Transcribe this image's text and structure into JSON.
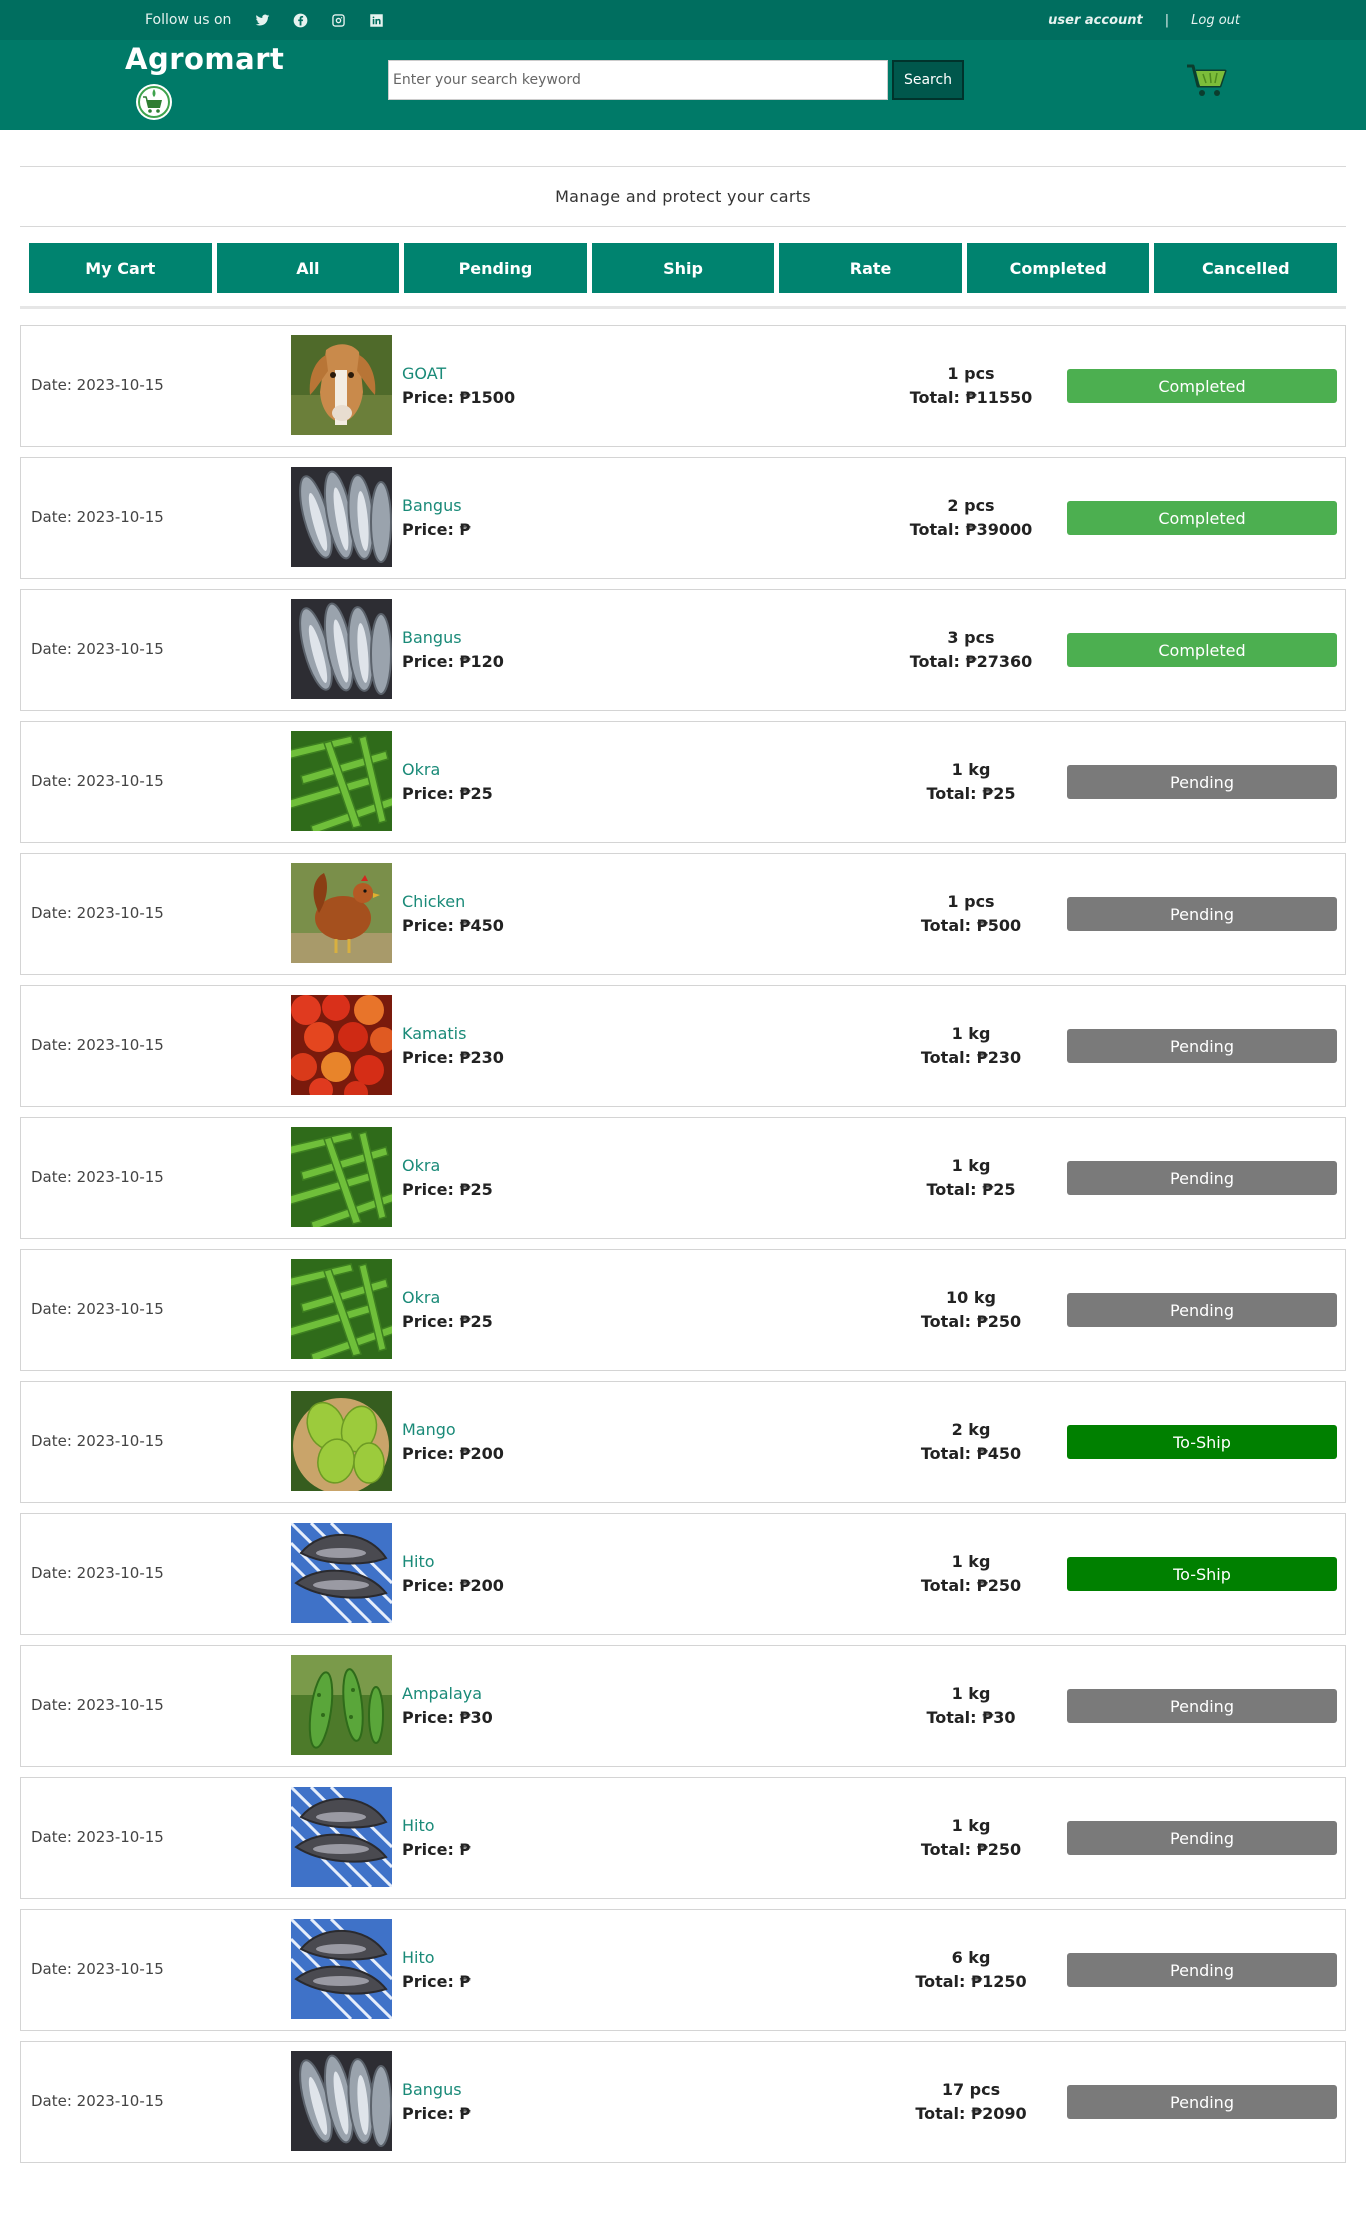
{
  "topbar": {
    "follow_label": "Follow us on",
    "social_icons": [
      "twitter-icon",
      "facebook-icon",
      "instagram-icon",
      "linkedin-icon"
    ],
    "user_account": "user account",
    "separator": "|",
    "logout": "Log out"
  },
  "header": {
    "brand": "Agromart",
    "search_placeholder": "Enter your search keyword",
    "search_button": "Search"
  },
  "banner": {
    "text": "Manage and protect your carts"
  },
  "tabs": [
    {
      "label": "My Cart"
    },
    {
      "label": "All"
    },
    {
      "label": "Pending"
    },
    {
      "label": "Ship"
    },
    {
      "label": "Rate"
    },
    {
      "label": "Completed"
    },
    {
      "label": "Cancelled"
    }
  ],
  "colors": {
    "topbar": "#006e5f",
    "header": "#007a68",
    "tab": "#00836f",
    "completed": "#4caf50",
    "pending": "#7a7a7a",
    "toship": "#008000"
  },
  "orders": [
    {
      "date": "Date: 2023-10-15",
      "name": "GOAT",
      "price": "Price: ₱1500",
      "qty": "1 pcs",
      "total": "Total: ₱11550",
      "status": "Completed",
      "status_kind": "completed",
      "image": "goat"
    },
    {
      "date": "Date: 2023-10-15",
      "name": "Bangus",
      "price": "Price: ₱",
      "qty": "2 pcs",
      "total": "Total: ₱39000",
      "status": "Completed",
      "status_kind": "completed",
      "image": "fish"
    },
    {
      "date": "Date: 2023-10-15",
      "name": "Bangus",
      "price": "Price: ₱120",
      "qty": "3 pcs",
      "total": "Total: ₱27360",
      "status": "Completed",
      "status_kind": "completed",
      "image": "fish"
    },
    {
      "date": "Date: 2023-10-15",
      "name": "Okra",
      "price": "Price: ₱25",
      "qty": "1 kg",
      "total": "Total: ₱25",
      "status": "Pending",
      "status_kind": "pending",
      "image": "okra"
    },
    {
      "date": "Date: 2023-10-15",
      "name": "Chicken",
      "price": "Price: ₱450",
      "qty": "1 pcs",
      "total": "Total: ₱500",
      "status": "Pending",
      "status_kind": "pending",
      "image": "chicken"
    },
    {
      "date": "Date: 2023-10-15",
      "name": "Kamatis",
      "price": "Price: ₱230",
      "qty": "1 kg",
      "total": "Total: ₱230",
      "status": "Pending",
      "status_kind": "pending",
      "image": "tomato"
    },
    {
      "date": "Date: 2023-10-15",
      "name": "Okra",
      "price": "Price: ₱25",
      "qty": "1 kg",
      "total": "Total: ₱25",
      "status": "Pending",
      "status_kind": "pending",
      "image": "okra"
    },
    {
      "date": "Date: 2023-10-15",
      "name": "Okra",
      "price": "Price: ₱25",
      "qty": "10 kg",
      "total": "Total: ₱250",
      "status": "Pending",
      "status_kind": "pending",
      "image": "okra"
    },
    {
      "date": "Date: 2023-10-15",
      "name": "Mango",
      "price": "Price: ₱200",
      "qty": "2 kg",
      "total": "Total: ₱450",
      "status": "To-Ship",
      "status_kind": "toship",
      "image": "mango"
    },
    {
      "date": "Date: 2023-10-15",
      "name": "Hito",
      "price": "Price: ₱200",
      "qty": "1 kg",
      "total": "Total: ₱250",
      "status": "To-Ship",
      "status_kind": "toship",
      "image": "catfish"
    },
    {
      "date": "Date: 2023-10-15",
      "name": "Ampalaya",
      "price": "Price: ₱30",
      "qty": "1 kg",
      "total": "Total: ₱30",
      "status": "Pending",
      "status_kind": "pending",
      "image": "ampalaya"
    },
    {
      "date": "Date: 2023-10-15",
      "name": "Hito",
      "price": "Price: ₱",
      "qty": "1 kg",
      "total": "Total: ₱250",
      "status": "Pending",
      "status_kind": "pending",
      "image": "catfish"
    },
    {
      "date": "Date: 2023-10-15",
      "name": "Hito",
      "price": "Price: ₱",
      "qty": "6 kg",
      "total": "Total: ₱1250",
      "status": "Pending",
      "status_kind": "pending",
      "image": "catfish"
    },
    {
      "date": "Date: 2023-10-15",
      "name": "Bangus",
      "price": "Price: ₱",
      "qty": "17 pcs",
      "total": "Total: ₱2090",
      "status": "Pending",
      "status_kind": "pending",
      "image": "fish"
    }
  ]
}
